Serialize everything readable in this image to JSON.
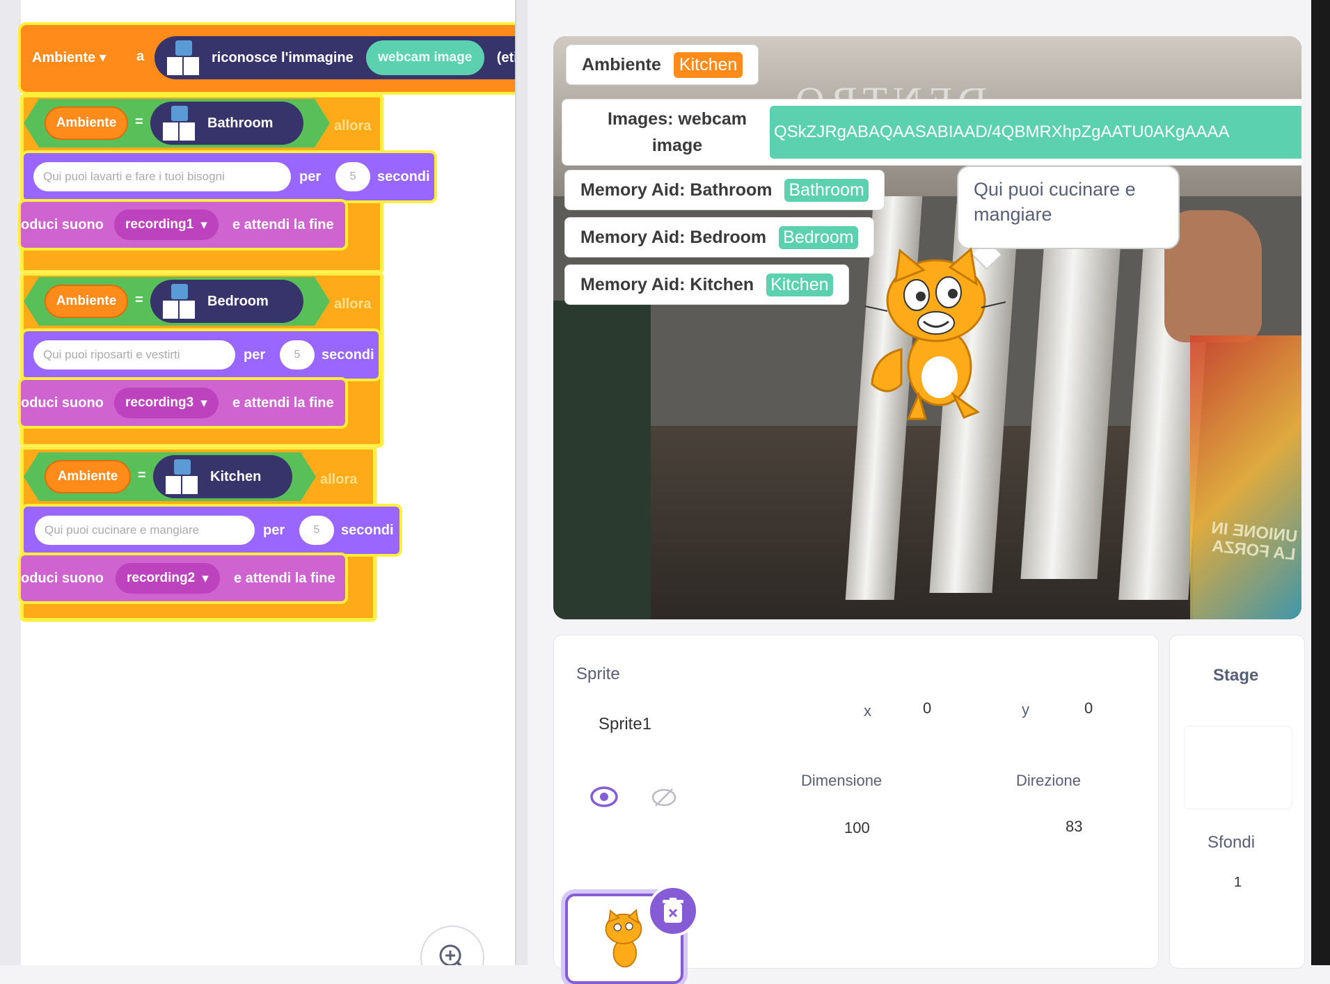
{
  "code": {
    "set_block": {
      "variable": "Ambiente",
      "to_label": "a",
      "recognise_label": "riconosce l'immagine",
      "image_input": "webcam image",
      "suffix": "(etic"
    },
    "conditions": [
      {
        "variable": "Ambiente",
        "equals": "=",
        "value": "Bathroom",
        "then_label": "allora",
        "say": "Qui puoi lavarti e fare i tuoi bisogni",
        "per_label": "per",
        "seconds_value": "5",
        "seconds_label": "secondi",
        "sound_prefix": "oduci suono",
        "sound": "recording1",
        "sound_suffix": "e attendi la fine"
      },
      {
        "variable": "Ambiente",
        "equals": "=",
        "value": "Bedroom",
        "then_label": "allora",
        "say": "Qui puoi riposarti e vestirti",
        "per_label": "per",
        "seconds_value": "5",
        "seconds_label": "secondi",
        "sound_prefix": "oduci suono",
        "sound": "recording3",
        "sound_suffix": "e attendi la fine"
      },
      {
        "variable": "Ambiente",
        "equals": "=",
        "value": "Kitchen",
        "then_label": "allora",
        "say": "Qui puoi cucinare e mangiare",
        "per_label": "per",
        "seconds_value": "5",
        "seconds_label": "secondi",
        "sound_prefix": "oduci suono",
        "sound": "recording2",
        "sound_suffix": "e attendi la fine"
      }
    ]
  },
  "stage": {
    "monitors": {
      "ambiente": {
        "label": "Ambiente",
        "value": "Kitchen"
      },
      "images": {
        "label_line1": "Images: webcam",
        "label_line2": "image",
        "value": "QSkZJRgABAQAASABIAAD/4QBMRXhpZgAATU0AKgAAAA"
      },
      "bathroom": {
        "label": "Memory Aid: Bathroom",
        "value": "Bathroom"
      },
      "bedroom": {
        "label": "Memory Aid: Bedroom",
        "value": "Bedroom"
      },
      "kitchen": {
        "label": "Memory Aid: Kitchen",
        "value": "Kitchen"
      }
    },
    "speech": "Qui puoi cucinare e mangiare",
    "wall_text": "DENTRO",
    "poster_text": "UNIONE IN LA FORZA"
  },
  "sprite_info": {
    "section_label": "Sprite",
    "name": "Sprite1",
    "x_label": "x",
    "x_value": "0",
    "y_label": "y",
    "y_value": "0",
    "size_label": "Dimensione",
    "size_value": "100",
    "direction_label": "Direzione",
    "direction_value": "83"
  },
  "stage_pane": {
    "title": "Stage",
    "backdrops_label": "Sfondi",
    "backdrops_count": "1"
  },
  "colors": {
    "control": "#ffab19",
    "operators": "#59c059",
    "looks": "#9966ff",
    "sound": "#cf63cf",
    "variables": "#ff8c1a",
    "ml": "#37336b",
    "accent": "#855cd6"
  },
  "icons": [
    "chevron-down-icon",
    "ml-model-icon",
    "zoom-in-icon",
    "eye-icon",
    "eye-off-icon",
    "trash-icon",
    "cat-sprite-icon"
  ]
}
